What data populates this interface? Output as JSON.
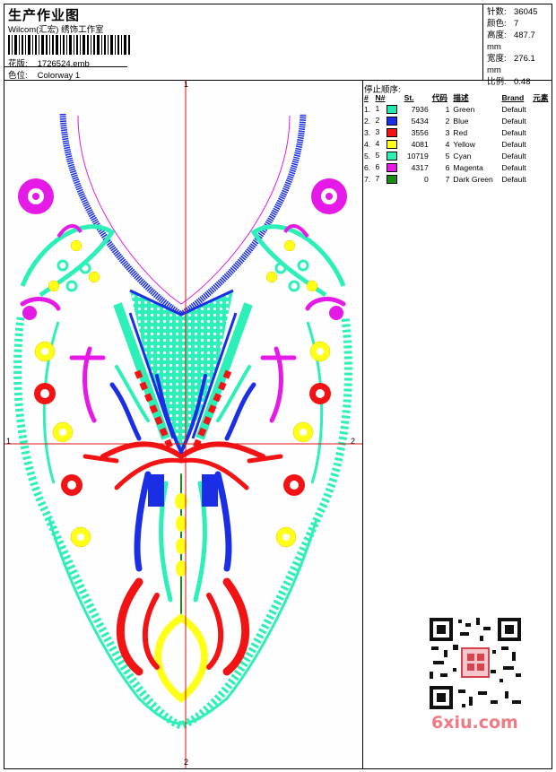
{
  "header": {
    "title": "生产作业图",
    "subtitle": "Wilcom(汇宏) 绣饰工作室",
    "design_file_label": "花版:",
    "design_file": "1726524.emb",
    "colorway_label": "色位:",
    "colorway": "Colorway 1"
  },
  "stats": [
    {
      "label": "针数:",
      "value": "36045"
    },
    {
      "label": "颜色:",
      "value": "7"
    },
    {
      "label": "高度:",
      "value": "487.7 mm"
    },
    {
      "label": "宽度:",
      "value": "276.1 mm"
    },
    {
      "label": "比例:",
      "value": "0.48"
    }
  ],
  "legend": {
    "title": "停止顺序:",
    "columns": [
      "#",
      "N#",
      "St.",
      "代码",
      "描述",
      "Brand",
      "元素"
    ],
    "rows": [
      {
        "idx": "1.",
        "n": "1",
        "color": "#22e8b0",
        "st": "7936",
        "code": "1",
        "desc": "Green",
        "brand": "Default"
      },
      {
        "idx": "2.",
        "n": "2",
        "color": "#1a2ee6",
        "st": "5434",
        "code": "2",
        "desc": "Blue",
        "brand": "Default"
      },
      {
        "idx": "3.",
        "n": "3",
        "color": "#f21414",
        "st": "3556",
        "code": "3",
        "desc": "Red",
        "brand": "Default"
      },
      {
        "idx": "4.",
        "n": "4",
        "color": "#ffff1a",
        "st": "4081",
        "code": "4",
        "desc": "Yellow",
        "brand": "Default"
      },
      {
        "idx": "5.",
        "n": "5",
        "color": "#2df0b8",
        "st": "10719",
        "code": "5",
        "desc": "Cyan",
        "brand": "Default"
      },
      {
        "idx": "6.",
        "n": "6",
        "color": "#e61ae6",
        "st": "4317",
        "code": "6",
        "desc": "Magenta",
        "brand": "Default"
      },
      {
        "idx": "7.",
        "n": "7",
        "color": "#1a8c1a",
        "st": "0",
        "code": "7",
        "desc": "Dark Green",
        "brand": "Default"
      }
    ]
  },
  "axes": {
    "top": "1",
    "bottom": "2",
    "left": "1",
    "right": "2"
  },
  "watermark": "6xiu.com"
}
